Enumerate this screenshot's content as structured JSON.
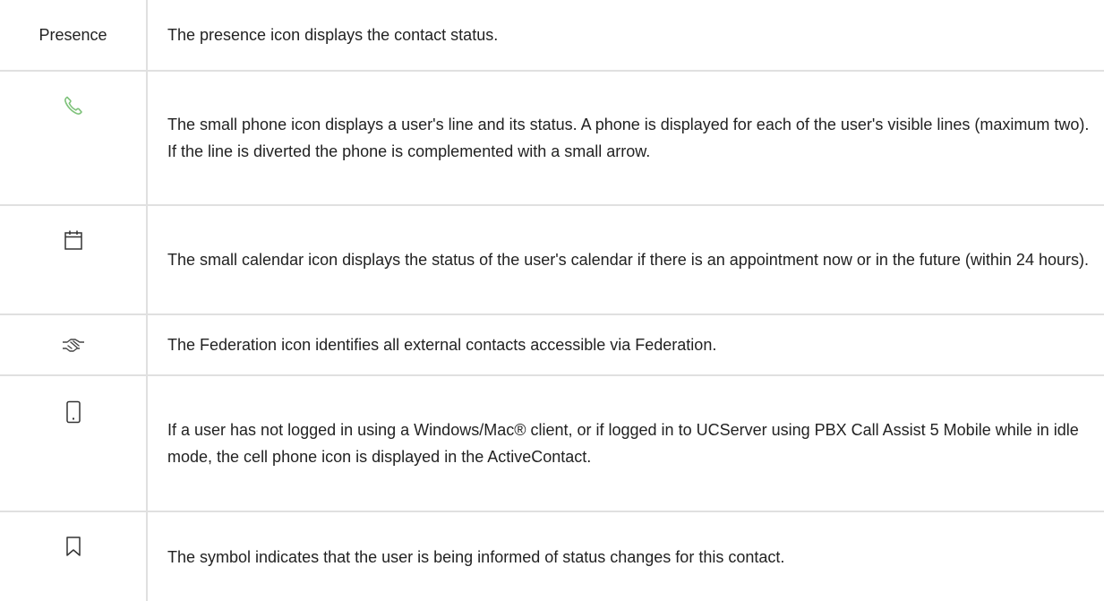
{
  "rows": [
    {
      "icon": "presence-label",
      "label": "Presence",
      "description": "The presence icon displays the contact status."
    },
    {
      "icon": "phone-icon",
      "icon_color": "#7ec27a",
      "description": "The small phone icon displays a user's line and its status. A phone is displayed for each of the user's visible lines (maximum two). If the line is diverted the phone is complemented with a small arrow."
    },
    {
      "icon": "calendar-icon",
      "description": "The small calendar icon displays the status of the user's calendar if there is an appointment now or in the future (within 24 hours)."
    },
    {
      "icon": "federation-handshake-icon",
      "description": "The Federation icon identifies all external contacts accessible via Federation."
    },
    {
      "icon": "cell-phone-icon",
      "description": "If a user has not logged in using a Windows/Mac® client, or if logged in to UCServer using PBX Call Assist 5 Mobile while in idle mode, the cell phone icon is displayed in the ActiveContact."
    },
    {
      "icon": "bookmark-icon",
      "description": "The symbol indicates that the user is being informed of status changes for this contact."
    }
  ]
}
